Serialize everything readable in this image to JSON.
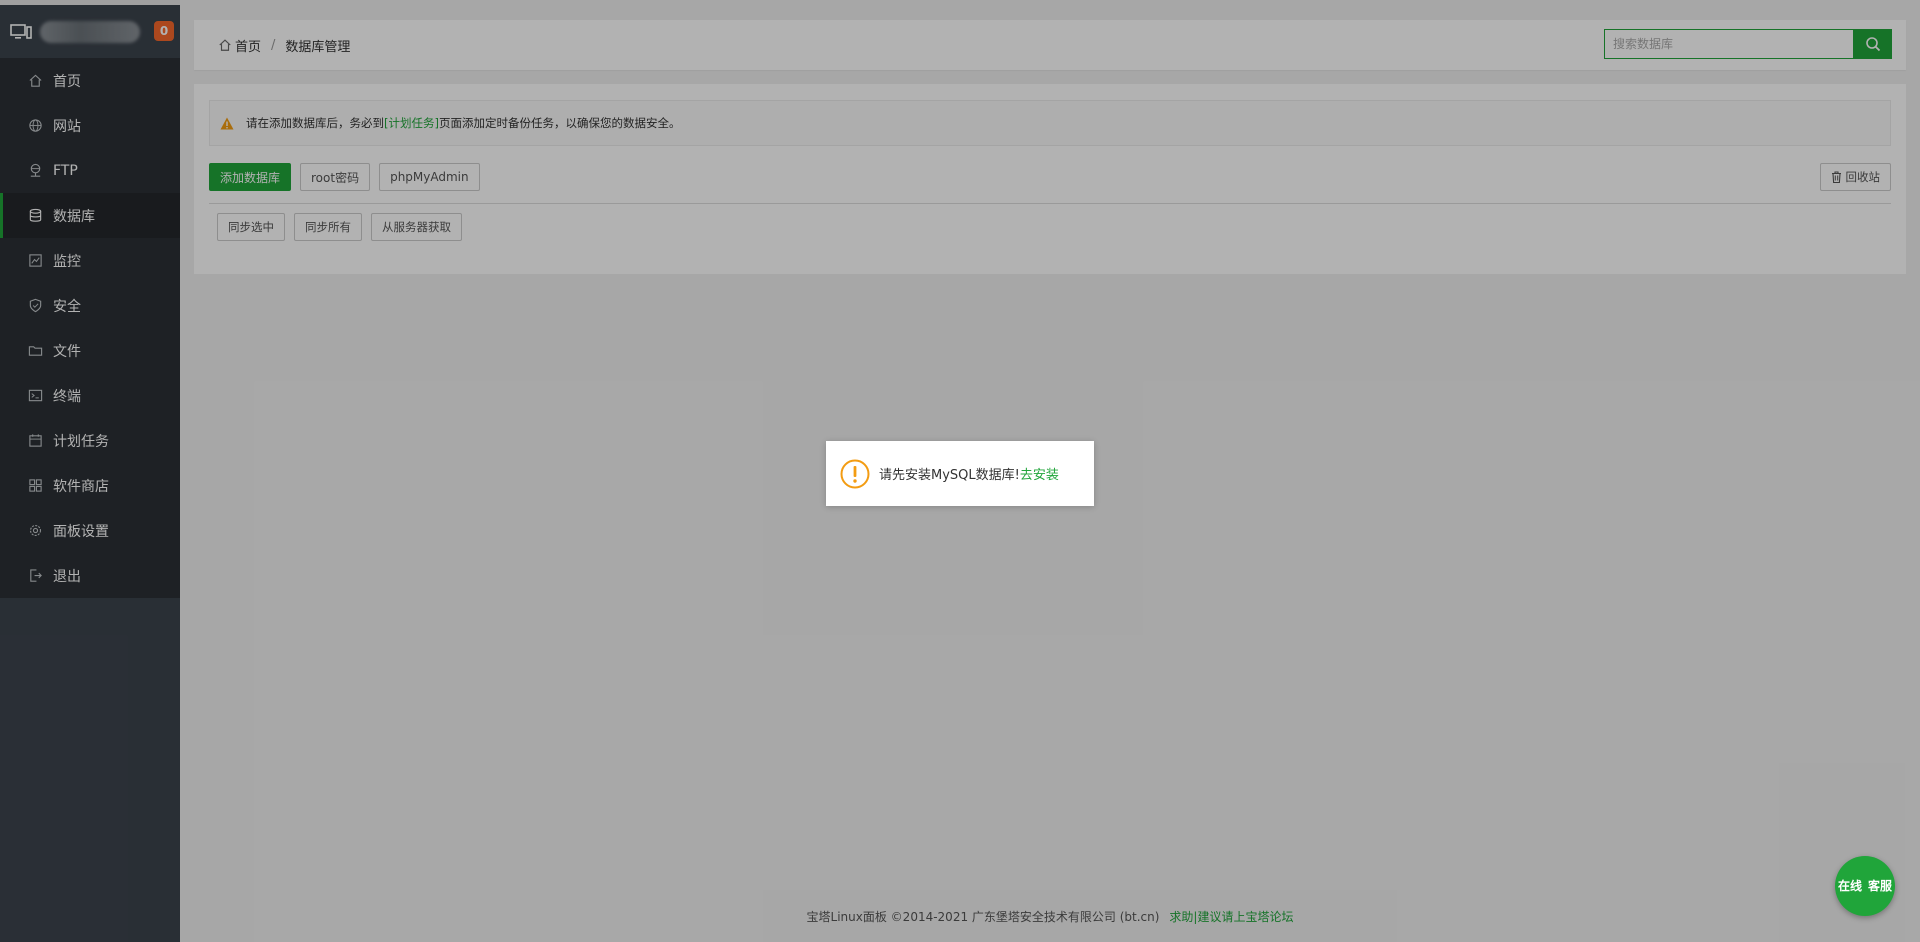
{
  "sidebar": {
    "badge_count": "0",
    "items": [
      {
        "label": "首页",
        "icon": "home-icon"
      },
      {
        "label": "网站",
        "icon": "globe-icon"
      },
      {
        "label": "FTP",
        "icon": "ftp-icon"
      },
      {
        "label": "数据库",
        "icon": "database-icon",
        "active": true
      },
      {
        "label": "监控",
        "icon": "monitor-chart-icon"
      },
      {
        "label": "安全",
        "icon": "shield-icon"
      },
      {
        "label": "文件",
        "icon": "folder-icon"
      },
      {
        "label": "终端",
        "icon": "terminal-icon"
      },
      {
        "label": "计划任务",
        "icon": "calendar-icon"
      },
      {
        "label": "软件商店",
        "icon": "apps-grid-icon"
      },
      {
        "label": "面板设置",
        "icon": "gear-icon"
      },
      {
        "label": "退出",
        "icon": "logout-icon"
      }
    ]
  },
  "header": {
    "breadcrumb_home": "首页",
    "breadcrumb_sep": "/",
    "breadcrumb_current": "数据库管理",
    "search_placeholder": "搜索数据库"
  },
  "alert": {
    "text_before": "请在添加数据库后，务必到",
    "link_text": "[计划任务]",
    "text_after": "页面添加定时备份任务，以确保您的数据安全。"
  },
  "toolbar": {
    "add_db": "添加数据库",
    "root_pwd": "root密码",
    "phpmyadmin": "phpMyAdmin",
    "recycle": "回收站",
    "sync_selected": "同步选中",
    "sync_all": "同步所有",
    "fetch_server": "从服务器获取"
  },
  "toast": {
    "message": "请先安装MySQL数据库!",
    "action": "去安装"
  },
  "footer": {
    "copyright": "宝塔Linux面板 ©2014-2021 广东堡塔安全技术有限公司 (bt.cn)",
    "forum_link": "求助|建议请上宝塔论坛"
  },
  "chat": {
    "line1": "在线",
    "line2": "客服"
  },
  "colors": {
    "accent": "#20a53a",
    "sidebar_bg": "#3c444d",
    "menu_bg": "#2b3035",
    "badge": "#f7672b",
    "warning": "#f39c12"
  }
}
